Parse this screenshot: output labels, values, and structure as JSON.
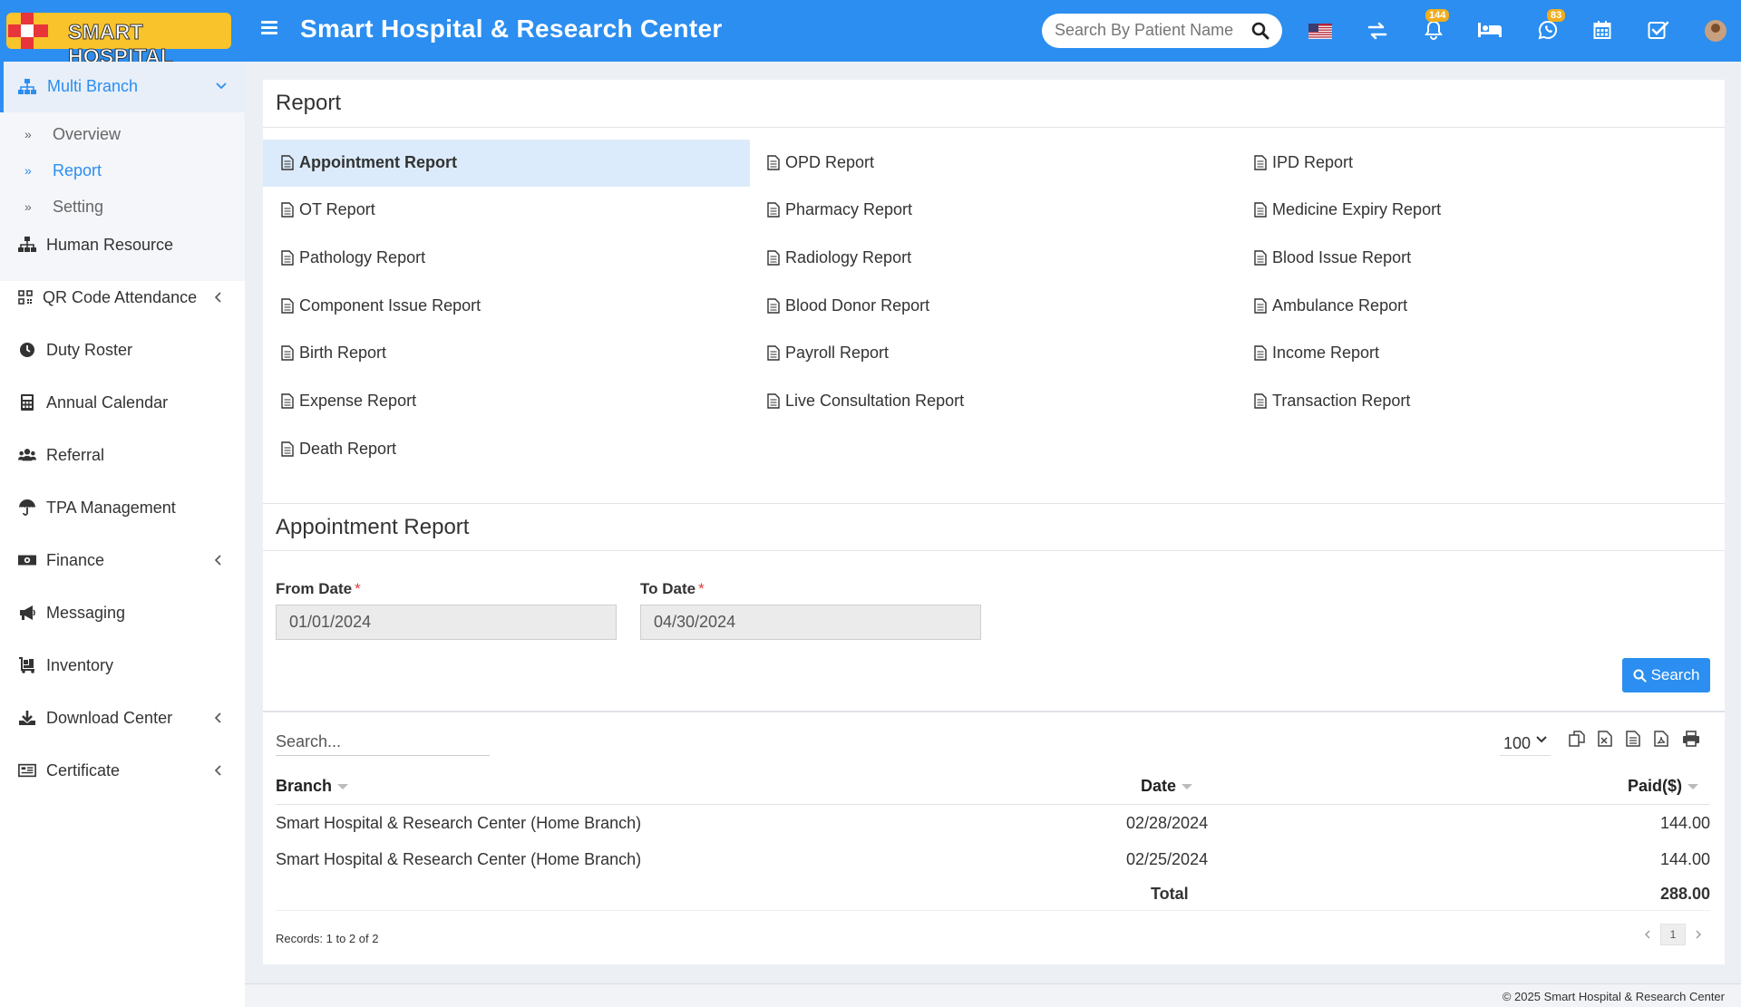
{
  "header": {
    "logo_text": "SMART HOSPITAL",
    "title": "Smart Hospital & Research Center",
    "search_placeholder": "Search By Patient Name",
    "notifications_count": "144",
    "whatsapp_count": "83"
  },
  "sidebar": {
    "active_group": "Multi Branch",
    "subitems": [
      "Overview",
      "Report",
      "Setting"
    ],
    "items": [
      {
        "label": "Human Resource",
        "icon": "sitemap-icon"
      },
      {
        "label": "QR Code Attendance",
        "icon": "qrcode-icon"
      },
      {
        "label": "Duty Roster",
        "icon": "clock-icon"
      },
      {
        "label": "Annual Calendar",
        "icon": "calculator-icon"
      },
      {
        "label": "Referral",
        "icon": "users-icon"
      },
      {
        "label": "TPA Management",
        "icon": "umbrella-icon"
      },
      {
        "label": "Finance",
        "icon": "money-icon"
      },
      {
        "label": "Messaging",
        "icon": "bullhorn-icon"
      },
      {
        "label": "Inventory",
        "icon": "cart-icon"
      },
      {
        "label": "Download Center",
        "icon": "download-icon"
      },
      {
        "label": "Certificate",
        "icon": "certificate-icon"
      }
    ]
  },
  "report": {
    "title": "Report",
    "links": [
      "Appointment Report",
      "OPD Report",
      "IPD Report",
      "OT Report",
      "Pharmacy Report",
      "Medicine Expiry Report",
      "Pathology Report",
      "Radiology Report",
      "Blood Issue Report",
      "Component Issue Report",
      "Blood Donor Report",
      "Ambulance Report",
      "Birth Report",
      "Payroll Report",
      "Income Report",
      "Expense Report",
      "Live Consultation Report",
      "Transaction Report",
      "Death Report"
    ]
  },
  "appointment": {
    "title": "Appointment Report",
    "from_label": "From Date",
    "to_label": "To Date",
    "required_mark": "*",
    "from_value": "01/01/2024",
    "to_value": "04/30/2024",
    "search_button": "Search"
  },
  "table": {
    "search_placeholder": "Search...",
    "page_size": "100",
    "columns": [
      "Branch",
      "Date",
      "Paid($)"
    ],
    "rows": [
      [
        "Smart Hospital & Research Center (Home Branch)",
        "02/28/2024",
        "144.00"
      ],
      [
        "Smart Hospital & Research Center (Home Branch)",
        "02/25/2024",
        "144.00"
      ]
    ],
    "total_label": "Total",
    "total_value": "288.00",
    "records_text": "Records: 1 to 2 of 2",
    "page": "1"
  },
  "footer": {
    "copyright": "© 2025 Smart Hospital & Research Center"
  },
  "colors": {
    "primary": "#2b8ef0",
    "logo_bg": "#f9c32b",
    "badge": "#f0ad1e",
    "active_row": "#dbebfb"
  }
}
